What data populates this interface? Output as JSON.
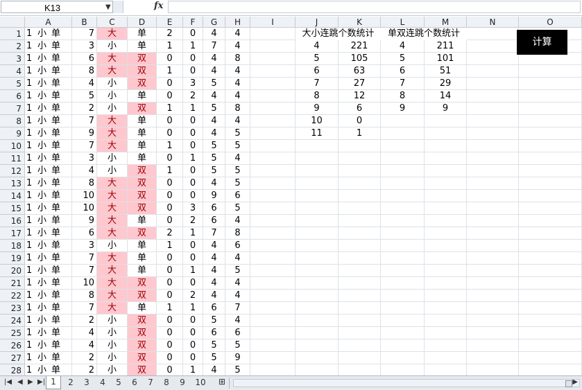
{
  "formula_bar": {
    "cell_ref": "K13",
    "fx_label": "fx",
    "formula": ""
  },
  "columns": [
    "A",
    "B",
    "C",
    "D",
    "E",
    "F",
    "G",
    "H",
    "I",
    "J",
    "K",
    "L",
    "M",
    "N",
    "O"
  ],
  "rows": [
    [
      "1",
      "小",
      "单",
      "7",
      "大",
      "单",
      "2",
      "0",
      "4",
      "4"
    ],
    [
      "1",
      "小",
      "单",
      "3",
      "小",
      "单",
      "1",
      "1",
      "7",
      "4"
    ],
    [
      "1",
      "小",
      "单",
      "6",
      "大",
      "双",
      "0",
      "0",
      "4",
      "8"
    ],
    [
      "1",
      "小",
      "单",
      "8",
      "大",
      "双",
      "1",
      "0",
      "4",
      "4"
    ],
    [
      "1",
      "小",
      "单",
      "4",
      "小",
      "双",
      "0",
      "3",
      "5",
      "4"
    ],
    [
      "1",
      "小",
      "单",
      "5",
      "小",
      "单",
      "0",
      "2",
      "4",
      "4"
    ],
    [
      "1",
      "小",
      "单",
      "2",
      "小",
      "双",
      "1",
      "1",
      "5",
      "8"
    ],
    [
      "1",
      "小",
      "单",
      "7",
      "大",
      "单",
      "0",
      "0",
      "4",
      "4"
    ],
    [
      "1",
      "小",
      "单",
      "9",
      "大",
      "单",
      "0",
      "0",
      "4",
      "5"
    ],
    [
      "1",
      "小",
      "单",
      "7",
      "大",
      "单",
      "1",
      "0",
      "5",
      "5"
    ],
    [
      "1",
      "小",
      "单",
      "3",
      "小",
      "单",
      "0",
      "1",
      "5",
      "4"
    ],
    [
      "1",
      "小",
      "单",
      "4",
      "小",
      "双",
      "1",
      "0",
      "5",
      "5"
    ],
    [
      "1",
      "小",
      "单",
      "8",
      "大",
      "双",
      "0",
      "0",
      "4",
      "5"
    ],
    [
      "1",
      "小",
      "单",
      "10",
      "大",
      "双",
      "0",
      "0",
      "9",
      "6"
    ],
    [
      "1",
      "小",
      "单",
      "10",
      "大",
      "双",
      "0",
      "3",
      "6",
      "5"
    ],
    [
      "1",
      "小",
      "单",
      "9",
      "大",
      "单",
      "0",
      "2",
      "6",
      "4"
    ],
    [
      "1",
      "小",
      "单",
      "6",
      "大",
      "双",
      "2",
      "1",
      "7",
      "8"
    ],
    [
      "1",
      "小",
      "单",
      "3",
      "小",
      "单",
      "1",
      "0",
      "4",
      "6"
    ],
    [
      "1",
      "小",
      "单",
      "7",
      "大",
      "单",
      "0",
      "0",
      "4",
      "4"
    ],
    [
      "1",
      "小",
      "单",
      "7",
      "大",
      "单",
      "0",
      "1",
      "4",
      "5"
    ],
    [
      "1",
      "小",
      "单",
      "10",
      "大",
      "双",
      "0",
      "0",
      "4",
      "4"
    ],
    [
      "1",
      "小",
      "单",
      "8",
      "大",
      "双",
      "0",
      "2",
      "4",
      "4"
    ],
    [
      "1",
      "小",
      "单",
      "7",
      "大",
      "单",
      "1",
      "1",
      "6",
      "7"
    ],
    [
      "1",
      "小",
      "单",
      "2",
      "小",
      "双",
      "0",
      "0",
      "5",
      "4"
    ],
    [
      "1",
      "小",
      "单",
      "4",
      "小",
      "双",
      "0",
      "0",
      "6",
      "6"
    ],
    [
      "1",
      "小",
      "单",
      "4",
      "小",
      "双",
      "0",
      "0",
      "5",
      "5"
    ],
    [
      "1",
      "小",
      "单",
      "2",
      "小",
      "双",
      "0",
      "0",
      "5",
      "9"
    ],
    [
      "1",
      "小",
      "单",
      "2",
      "小",
      "双",
      "0",
      "1",
      "4",
      "5"
    ]
  ],
  "stats": {
    "big_small_title": "大小连跳个数统计",
    "odd_even_title": "单双连跳个数统计",
    "big_small": [
      [
        "4",
        "221"
      ],
      [
        "5",
        "105"
      ],
      [
        "6",
        "63"
      ],
      [
        "7",
        "27"
      ],
      [
        "8",
        "12"
      ],
      [
        "9",
        "6"
      ],
      [
        "10",
        "0"
      ],
      [
        "11",
        "1"
      ]
    ],
    "odd_even": [
      [
        "4",
        "211"
      ],
      [
        "5",
        "101"
      ],
      [
        "6",
        "51"
      ],
      [
        "7",
        "29"
      ],
      [
        "8",
        "14"
      ],
      [
        "9",
        "9"
      ]
    ]
  },
  "calc_button_label": "计算",
  "sheet_tabs": [
    "1",
    "2",
    "3",
    "4",
    "5",
    "6",
    "7",
    "8",
    "9",
    "10"
  ],
  "active_tab": "1",
  "highlight_values": [
    "大",
    "双"
  ],
  "colors": {
    "highlight_bg": "#ffc7ce",
    "highlight_text": "#9c0006"
  }
}
